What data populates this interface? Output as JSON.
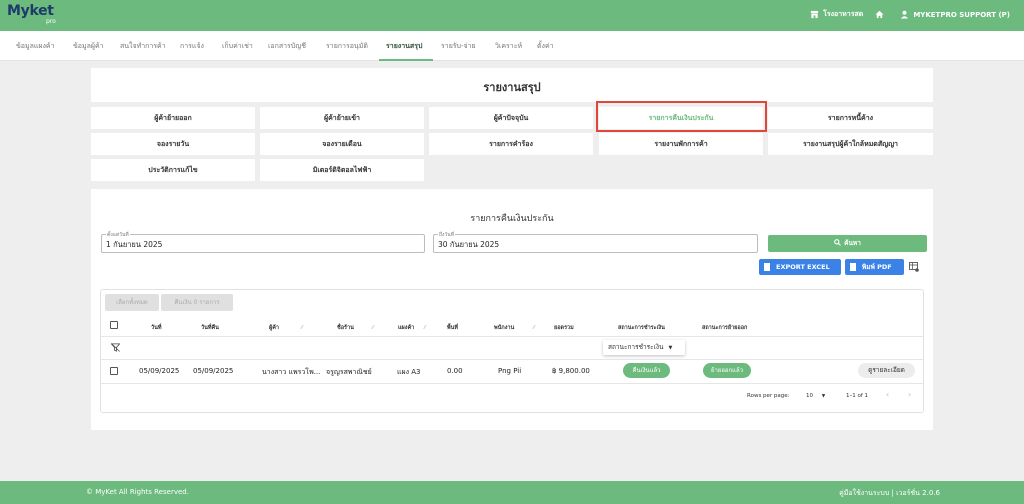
{
  "header": {
    "logo": "Myket",
    "logo_sub": "pro",
    "shop_label": "โรงอาหารสด",
    "user_label": "MYKETPRO SUPPORT (P)"
  },
  "nav": {
    "items": [
      "ข้อมูลแผงค้า",
      "ข้อมูลผู้ค้า",
      "สนใจทำการค้า",
      "การแจ้ง",
      "เก็บค่าเช่า",
      "เอกสารบัญชี",
      "รายการอนุมัติ",
      "รายงานสรุป",
      "รายรับ-จ่าย",
      "วิเคราะห์",
      "ตั้งค่า"
    ],
    "active_index": 7
  },
  "report": {
    "title": "รายงานสรุป",
    "buttons": [
      "ผู้ค้าย้ายออก",
      "ผู้ค้าย้ายเข้า",
      "ผู้ค้าปัจจุบัน",
      "รายการคืนเงินประกัน",
      "รายการหนี้ค้าง",
      "จองรายวัน",
      "จองรายเดือน",
      "รายการคำร้อง",
      "รายงานพักการค้า",
      "รายงานสรุปผู้ค้าใกล้หมดสัญญา",
      "ประวัติการแก้ไข",
      "มิเตอร์ดิจิตอลไฟฟ้า"
    ],
    "selected_index": 3
  },
  "refund": {
    "title": "รายการคืนเงินประกัน",
    "start_label": "ตั้งแต่วันที่",
    "start_value": "1 กันยายน 2025",
    "end_label": "ถึงวันที่",
    "end_value": "30 กันยายน 2025",
    "search_label": "ค้นหา",
    "excel_label": "EXPORT EXCEL",
    "pdf_label": "พิมพ์ PDF",
    "select_all_label": "เลือกทั้งหมด",
    "refund_count_label": "คืนเงิน 0 รายการ"
  },
  "table": {
    "columns": [
      "วันที่",
      "วันที่คืน",
      "ผู้ค้า",
      "ชื่อร้าน",
      "แผงค้า",
      "พื้นที่",
      "พนักงาน",
      "ยอดรวม",
      "สถานะการชำระเงิน",
      "สถานะการย้ายออก"
    ],
    "filter_status": "สถานะการชำระเงิน",
    "rows": [
      {
        "date": "05/09/2025",
        "return_date": "05/09/2025",
        "merchant": "นางสาว แพรวโพ...",
        "shop": "จรูญรสพาณิชย์",
        "stall": "แผง A3",
        "area": "0.00",
        "staff": "Png Pii",
        "total": "฿ 9,800.00",
        "payment_status": "คืนเงินแล้ว",
        "move_status": "ย้ายออกแล้ว",
        "detail_label": "ดูรายละเอียด"
      }
    ],
    "rows_per_page_label": "Rows per page:",
    "rows_per_page": "10",
    "range": "1–1 of 1"
  },
  "footer": {
    "copyright": "© MyKet All Rights Reserved.",
    "right": "คู่มือใช้งานระบบ | เวอร์ชั่น 2.0.6"
  },
  "colors": {
    "brand_green": "#6cba7d",
    "button_blue": "#3b82e6",
    "highlight_red": "#e0463a"
  }
}
